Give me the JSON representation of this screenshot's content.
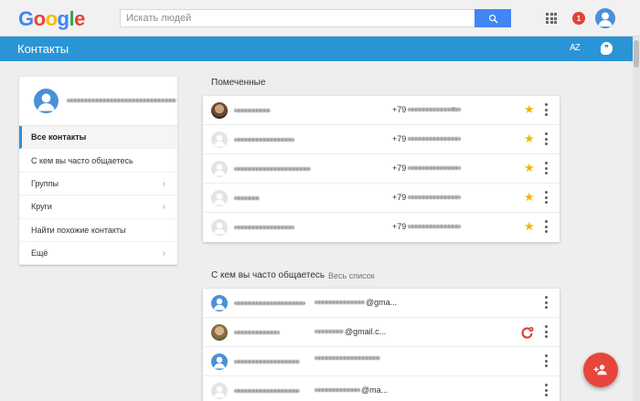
{
  "header": {
    "logo_letters": [
      {
        "char": "G",
        "color": "#4285f4"
      },
      {
        "char": "o",
        "color": "#ea4335"
      },
      {
        "char": "o",
        "color": "#fbbc05"
      },
      {
        "char": "g",
        "color": "#4285f4"
      },
      {
        "char": "l",
        "color": "#34a853"
      },
      {
        "char": "e",
        "color": "#ea4335"
      }
    ],
    "search_placeholder": "Искать людей",
    "notification_count": "1"
  },
  "appbar": {
    "title": "Контакты",
    "sort_label": "AZ",
    "color": "#2a94d6"
  },
  "sidebar": {
    "items": [
      {
        "label": "Все контакты",
        "active": true,
        "chevron": false
      },
      {
        "label": "С кем вы часто общаетесь",
        "active": false,
        "chevron": false
      },
      {
        "label": "Группы",
        "active": false,
        "chevron": true
      },
      {
        "label": "Круги",
        "active": false,
        "chevron": true
      },
      {
        "label": "Найти похожие контакты",
        "active": false,
        "chevron": false
      },
      {
        "label": "Ещё",
        "active": false,
        "chevron": true
      }
    ]
  },
  "starred": {
    "title": "Помеченные",
    "rows": [
      {
        "avatar": "photo",
        "phone_prefix": "+79",
        "has_dropdown": true
      },
      {
        "avatar": "default",
        "phone_prefix": "+79",
        "has_dropdown": false
      },
      {
        "avatar": "default",
        "phone_prefix": "+79",
        "has_dropdown": false
      },
      {
        "avatar": "default",
        "phone_prefix": "+79",
        "has_dropdown": false
      },
      {
        "avatar": "default",
        "phone_prefix": "+79",
        "has_dropdown": false
      }
    ]
  },
  "frequent": {
    "title": "С кем вы часто общаетесь",
    "link": "Весь список",
    "rows": [
      {
        "avatar": "blue",
        "email_suffix": "@gma...",
        "gplus": false
      },
      {
        "avatar": "photo2",
        "email_suffix": "@gmail.c...",
        "gplus": true
      },
      {
        "avatar": "blue",
        "email_suffix": "",
        "gplus": false
      },
      {
        "avatar": "default",
        "email_suffix": "@ma...",
        "gplus": false
      }
    ]
  },
  "colors": {
    "star": "#f4b400",
    "fab": "#e8453c",
    "notification": "#db4437"
  },
  "icons": [
    "search-icon",
    "apps-icon",
    "notifications-icon",
    "sort-az-icon",
    "hangouts-icon",
    "star-icon",
    "more-vert-icon",
    "google-plus-icon",
    "chevron-right-icon",
    "add-person-icon"
  ]
}
